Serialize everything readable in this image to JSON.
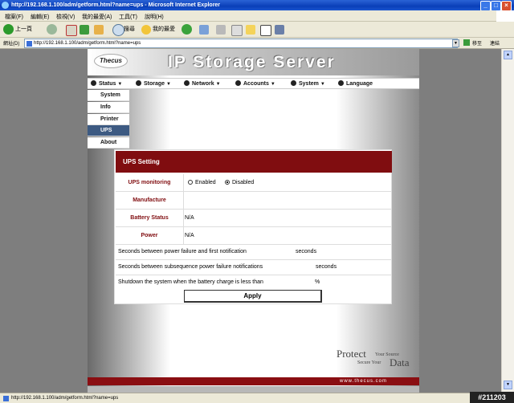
{
  "window": {
    "title": "http://192.168.1.100/adm/getform.html?name=ups - Microsoft Internet Explorer",
    "minimize_glyph": "_",
    "maximize_glyph": "□",
    "close_glyph": "×"
  },
  "menu": {
    "items": [
      "檔案(F)",
      "編輯(E)",
      "檢視(V)",
      "我的最愛(A)",
      "工具(T)",
      "說明(H)"
    ]
  },
  "toolbar": {
    "back_label": "上一頁",
    "search_label": "搜尋",
    "favorites_label": "我的最愛"
  },
  "address": {
    "label": "網址(D)",
    "url": "http://192.168.1.100/adm/getform.html?name=ups",
    "go_label": "移至",
    "links_label": "連結"
  },
  "site": {
    "logo": "Thecus",
    "brand": "IP Storage Server",
    "nav": [
      {
        "label": "Status",
        "icon": "status-icon"
      },
      {
        "label": "Storage",
        "icon": "storage-icon"
      },
      {
        "label": "Network",
        "icon": "network-icon"
      },
      {
        "label": "Accounts",
        "icon": "accounts-icon"
      },
      {
        "label": "System",
        "icon": "system-icon"
      },
      {
        "label": "Language",
        "icon": "language-icon"
      }
    ],
    "submenu": [
      "System",
      "Info",
      "Printer",
      "UPS",
      "About"
    ],
    "submenu_active": "UPS",
    "footer": "www.thecus.com",
    "tagline": {
      "protect": "Protect",
      "your_source": "Your Source",
      "secure": "Secure Your",
      "data": "Data"
    }
  },
  "ups": {
    "heading": "UPS Setting",
    "monitoring_label": "UPS monitoring",
    "enabled_label": "Enabled",
    "disabled_label": "Disabled",
    "monitoring_selected": "Disabled",
    "manufacture_label": "Manufacture",
    "manufacture_value": "",
    "battery_label": "Battery Status",
    "battery_value": "N/A",
    "power_label": "Power",
    "power_value": "N/A",
    "first_notification": "Seconds between power failure and first notification",
    "first_unit": "seconds",
    "subsequent_notification": "Seconds between subsequence power failure notifications",
    "subsequent_unit": "seconds",
    "shutdown_label": "Shutdown the system when the battery charge is less than",
    "shutdown_unit": "%",
    "apply_label": "Apply"
  },
  "status": {
    "text": "http://192.168.1.100/adm/getform.html?name=ups",
    "watermark": "#211203"
  },
  "colors": {
    "header_red": "#800d10",
    "active_menu": "#3d5a82"
  }
}
